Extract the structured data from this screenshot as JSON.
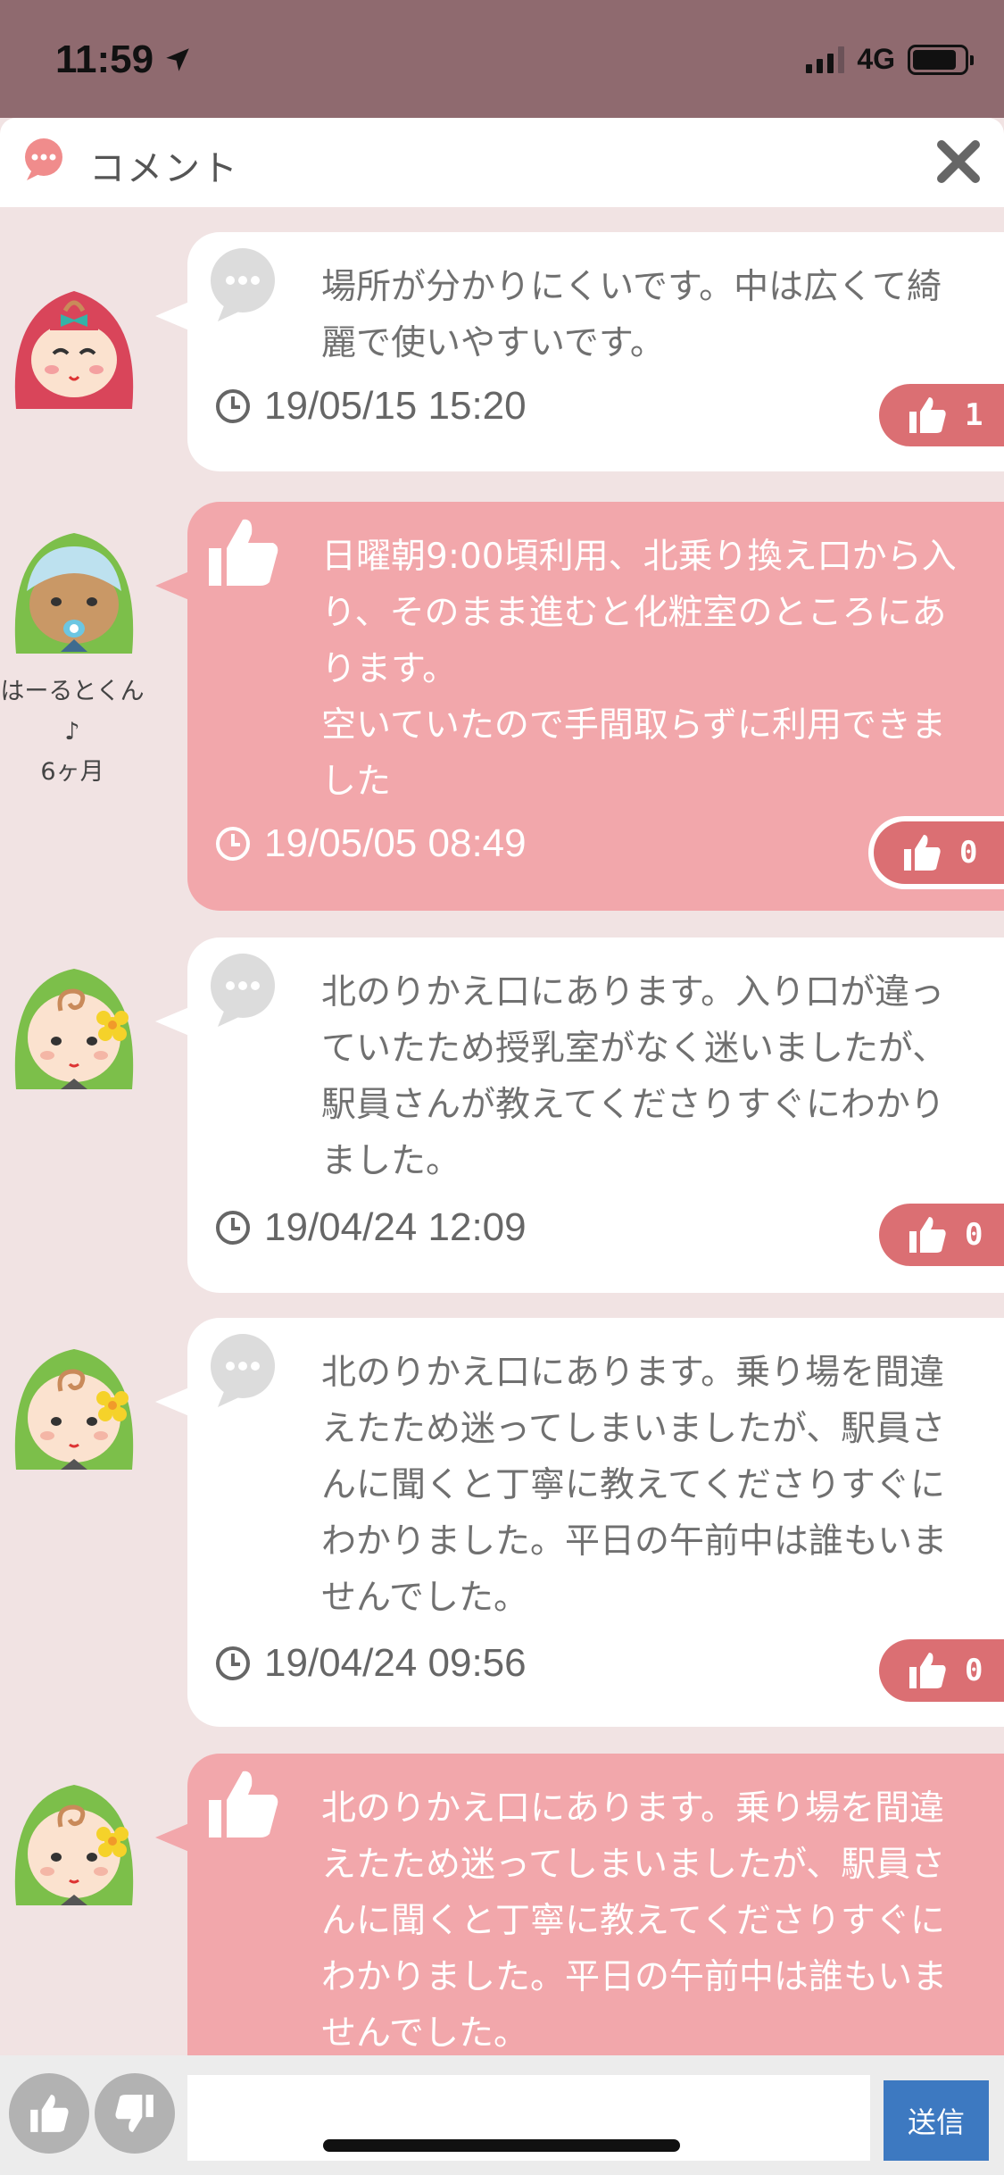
{
  "status_bar": {
    "time": "11:59",
    "network": "4G",
    "battery_level": 0.85
  },
  "header": {
    "title": "コメント",
    "close_icon": "close-icon",
    "chat_icon": "chat-bubble-icon"
  },
  "colors": {
    "status_bar_bg": "#8f6a6f",
    "page_bg": "#f1e3e3",
    "pink_bubble": "#f2a7ab",
    "like_button": "#db6f73",
    "send_button": "#3d79c1"
  },
  "comments": [
    {
      "type": "comment",
      "avatar": "red-hood-baby-avatar",
      "user_name": "",
      "user_age": "",
      "text": "場所が分かりにくいです。中は広くて綺麗で使いやすいです。",
      "timestamp": "19/05/15 15:20",
      "likes": "1"
    },
    {
      "type": "recommend",
      "avatar": "blue-hat-baby-avatar",
      "user_name": "はーるとくん♪",
      "user_age": "6ヶ月",
      "text": "日曜朝9:00頃利用、北乗り換え口から入り、そのまま進むと化粧室のところにあります。\n空いていたので手間取らずに利用できました",
      "timestamp": "19/05/05 08:49",
      "likes": "0"
    },
    {
      "type": "comment",
      "avatar": "green-flower-baby-avatar",
      "user_name": "",
      "user_age": "",
      "text": "北のりかえ口にあります。入り口が違っていたため授乳室がなく迷いましたが、駅員さんが教えてくださりすぐにわかりました。",
      "timestamp": "19/04/24 12:09",
      "likes": "0"
    },
    {
      "type": "comment",
      "avatar": "green-flower-baby-avatar",
      "user_name": "",
      "user_age": "",
      "text": "北のりかえ口にあります。乗り場を間違えたため迷ってしまいましたが、駅員さんに聞くと丁寧に教えてくださりすぐにわかりました。平日の午前中は誰もいませんでした。",
      "timestamp": "19/04/24 09:56",
      "likes": "0"
    },
    {
      "type": "recommend",
      "avatar": "green-flower-baby-avatar",
      "user_name": "",
      "user_age": "",
      "text": "北のりかえ口にあります。乗り場を間違えたため迷ってしまいましたが、駅員さんに聞くと丁寧に教えてくださりすぐにわかりました。平日の午前中は誰もいませんでした。",
      "timestamp": "",
      "likes": ""
    }
  ],
  "bottom_bar": {
    "input_value": "",
    "send_label": "送信",
    "good_icon": "thumbs-up-icon",
    "bad_icon": "thumbs-down-icon"
  }
}
